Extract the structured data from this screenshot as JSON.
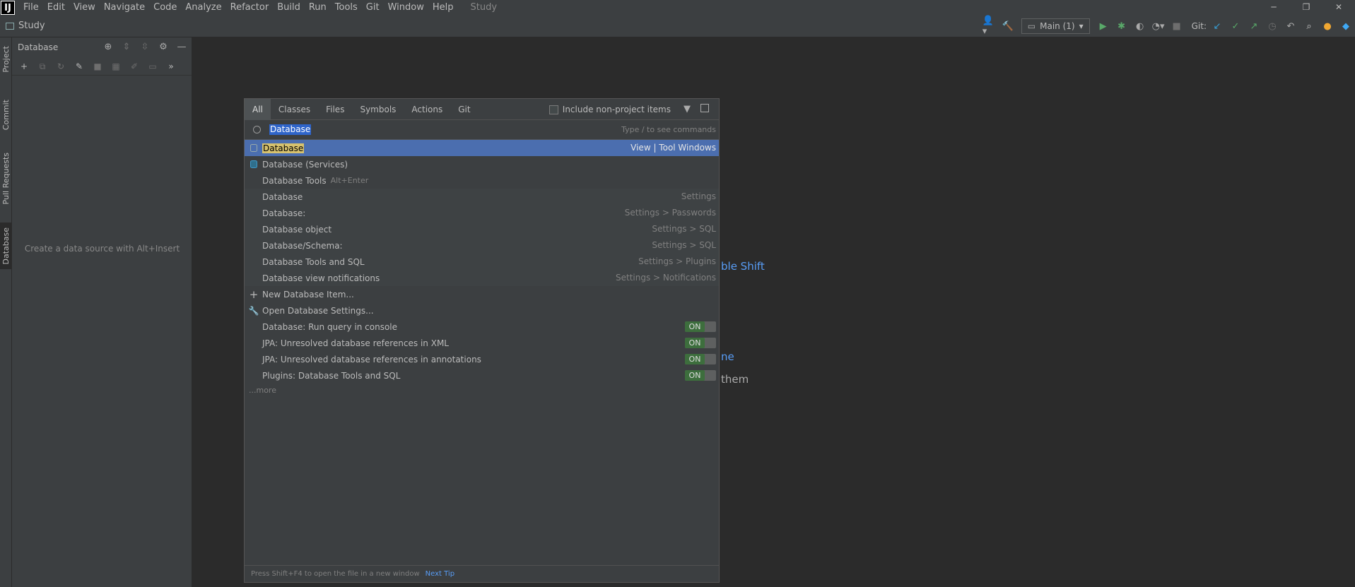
{
  "app": {
    "logo": "IJ",
    "window_title": "Study",
    "menu": [
      "File",
      "Edit",
      "View",
      "Navigate",
      "Code",
      "Analyze",
      "Refactor",
      "Build",
      "Run",
      "Tools",
      "Git",
      "Window",
      "Help"
    ]
  },
  "window_controls": {
    "minimize": "─",
    "maximize": "❐",
    "close": "✕"
  },
  "navbar": {
    "project": "Study",
    "run_config": "Main (1)",
    "git_label": "Git:"
  },
  "left_stripe": {
    "tabs": [
      "Project",
      "Commit",
      "Pull Requests",
      "Database"
    ]
  },
  "db_panel": {
    "title": "Database",
    "empty_text": "Create a data source with Alt+Insert"
  },
  "background_hints": [
    "ble Shift",
    "ne",
    "them"
  ],
  "popup": {
    "tabs": [
      "All",
      "Classes",
      "Files",
      "Symbols",
      "Actions",
      "Git"
    ],
    "include_non_project": "Include non-project items",
    "search_value": "Database",
    "search_hint": "Type / to see commands",
    "results": [
      {
        "name": "Database",
        "location": "View | Tool Windows",
        "icon": "database-icon"
      },
      {
        "name": "Database (Services)",
        "location": "",
        "icon": "database-services-icon"
      },
      {
        "name": "Database Tools",
        "shortcut": "Alt+Enter",
        "location": ""
      },
      {
        "name": "Database",
        "location": "Settings"
      },
      {
        "name": "Database:",
        "location": "Settings > Passwords"
      },
      {
        "name": "Database object",
        "location": "Settings > SQL"
      },
      {
        "name": "Database/Schema:",
        "location": "Settings > SQL"
      },
      {
        "name": "Database Tools and SQL",
        "location": "Settings > Plugins"
      },
      {
        "name": "Database view notifications",
        "location": "Settings > Notifications"
      },
      {
        "name": "New Database Item...",
        "icon": "plus-icon"
      },
      {
        "name": "Open Database Settings...",
        "icon": "wrench-icon"
      },
      {
        "name": "Database: Run query in console",
        "toggle": "ON"
      },
      {
        "name": "JPA: Unresolved database references in XML",
        "toggle": "ON"
      },
      {
        "name": "JPA: Unresolved database references in annotations",
        "toggle": "ON"
      },
      {
        "name": "Plugins: Database Tools and SQL",
        "toggle": "ON"
      }
    ],
    "more": "...more",
    "footer_text": "Press Shift+F4 to open the file in a new window",
    "footer_link": "Next Tip"
  }
}
